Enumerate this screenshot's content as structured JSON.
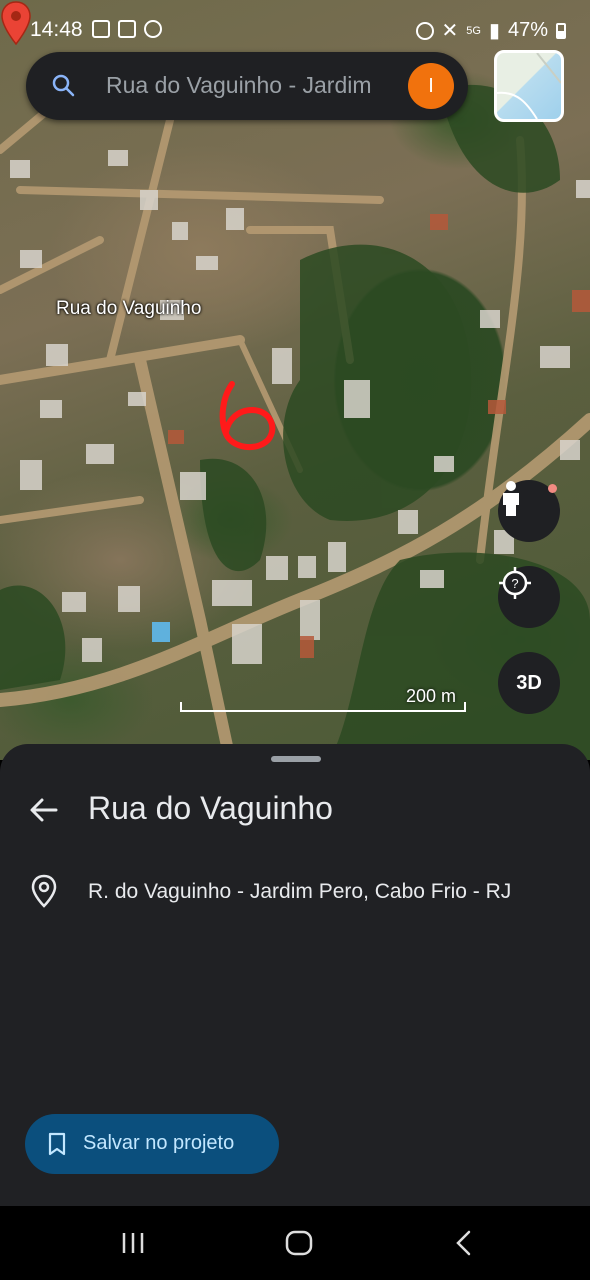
{
  "status_bar": {
    "time": "14:48",
    "network": "5G",
    "battery": "47%"
  },
  "search": {
    "query": "Rua do Vaguinho - Jardim",
    "avatar_letter": "I"
  },
  "map": {
    "pin_label": "Rua do Vaguinho",
    "scale_label": "200 m",
    "handwritten_mark": "6",
    "three_d_label": "3D"
  },
  "place": {
    "title": "Rua do Vaguinho",
    "address": "R. do Vaguinho - Jardim Pero, Cabo Frio - RJ"
  },
  "actions": {
    "save_label": "Salvar no projeto"
  },
  "colors": {
    "accent": "#f1720d",
    "save_button": "#0b4f7d",
    "sheet": "#202124"
  }
}
